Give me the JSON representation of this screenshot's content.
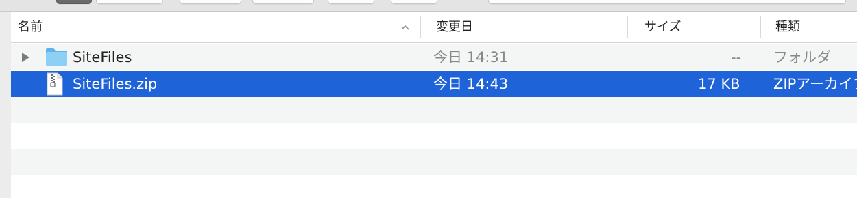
{
  "columns": {
    "name": "名前",
    "date": "変更日",
    "size": "サイズ",
    "kind": "種類"
  },
  "rows": [
    {
      "name": "SiteFiles",
      "date": "今日 14:31",
      "size": "--",
      "kind": "フォルダ",
      "icon": "folder-icon",
      "expandable": true,
      "selected": false
    },
    {
      "name": "SiteFiles.zip",
      "date": "今日 14:43",
      "size": "17 KB",
      "kind": "ZIPアーカイブ",
      "icon": "zip-file-icon",
      "expandable": false,
      "selected": true
    }
  ],
  "colors": {
    "selection": "#1f63d8",
    "alt_row": "#f4f5f5",
    "folder": "#7cc4f2"
  }
}
